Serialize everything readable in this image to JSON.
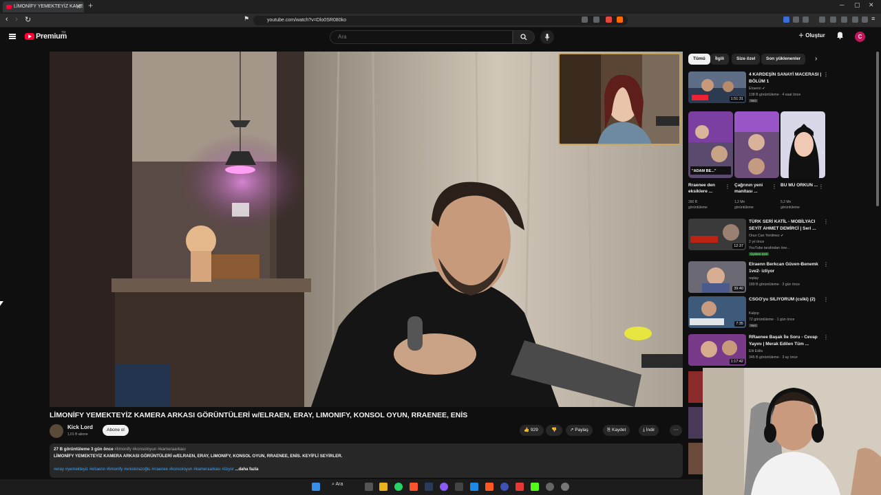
{
  "browser": {
    "tab_title": "LİMONİFY YEMEKTEYİZ KAME",
    "url": "youtube.com/watch?v=Dlo0SR080ko"
  },
  "header": {
    "logo_text": "Premium",
    "logo_sup": "TR",
    "search_placeholder": "Ara",
    "create_label": "Oluştur",
    "avatar_letter": "C"
  },
  "video": {
    "title": "LİMONİFY YEMEKTEYİZ KAMERA ARKASI GÖRÜNTÜLERİ w/ELRAEN, ERAY, LIMONIFY, KONSOL OYUN, RRAENEE, ENİS",
    "channel_name": "Kick Lord",
    "channel_subs": "1,01 B abone",
    "subscribe_label": "Abone ol",
    "likes": "929",
    "share_label": "Paylaş",
    "save_label": "Kaydet",
    "download_label": "İndir",
    "desc_views": "27 B görüntüleme",
    "desc_date": "3 gün önce",
    "desc_tags": "#limonify #konsoloyun #kameraarkası",
    "desc_line": "LİMONİFY YEMEKTEYİZ KAMERA ARKASI GÖRÜNTÜLERİ w/ELRAEN, ERAY, LIMONIFY, KONSOL OYUN, RRAENEE, ENİS. KEYİFLİ SEYİRLER.",
    "desc_hashtags": "#eray #yemekteyiz #elraenn #limonify #eniskirazoğlu #rraenee #konsoloyun #kameraarkası #iziyor",
    "more_label": "...daha fazla"
  },
  "chips": [
    "Tümü",
    "İlgili",
    "Size özel",
    "Son yüklenenler"
  ],
  "recommendations": [
    {
      "title": "4 KARDEŞİN SANAYİ MACERASI | BÖLÜM 1",
      "channel": "Elraenn",
      "meta": "138 B görüntüleme · 4 saat önce",
      "badge": "Yeni",
      "duration": "1:51:31"
    },
    {
      "title": "TÜRK SERİ KATİL - MOBİLYACI SEYİT AHMET DEMİRCİ | Seri ...",
      "channel": "Onur Can Yenilmez",
      "meta": "2 yıl önce",
      "extra": "YouTube tarafından öne...",
      "badge": "Üyelere özel",
      "duration": "12:37"
    },
    {
      "title": "Elraenn Berkcan Güven-Benemk 1ve2- izliyor",
      "channel": "replay",
      "meta": "189 B görüntüleme · 3 gün önce",
      "duration": "39:40"
    },
    {
      "title": "CSGO'yu SILIYORUM (cslki) (2)",
      "channel": "Kalpıp",
      "meta": "72 görüntüleme · 1 gün önce",
      "badge": "Yeni",
      "duration": "7:35"
    },
    {
      "title": "RRaenee Başak İle Soru - Cevap Yayını | Merak Edilen Tüm ...",
      "channel": "Elit Edits",
      "meta": "345 B görüntüleme · 3 ay önce",
      "duration": "1:17:42"
    }
  ],
  "shorts": [
    {
      "title": "Rraenee den eksiklere ...",
      "meta1": "390 B",
      "meta2": "görüntüleme",
      "overlay": "\"ADAM BE...\""
    },
    {
      "title": "Çağrının yeni manitası ...",
      "meta1": "1,2 Mn",
      "meta2": "görüntüleme"
    },
    {
      "title": "BU MU ORKUN ...",
      "meta1": "5,2 Mn",
      "meta2": "görüntüleme"
    }
  ],
  "taskbar": {
    "search_label": "Ara"
  },
  "colors": {
    "accent": "#ff0033",
    "background": "#0f0f0f",
    "link": "#3ea6ff"
  }
}
